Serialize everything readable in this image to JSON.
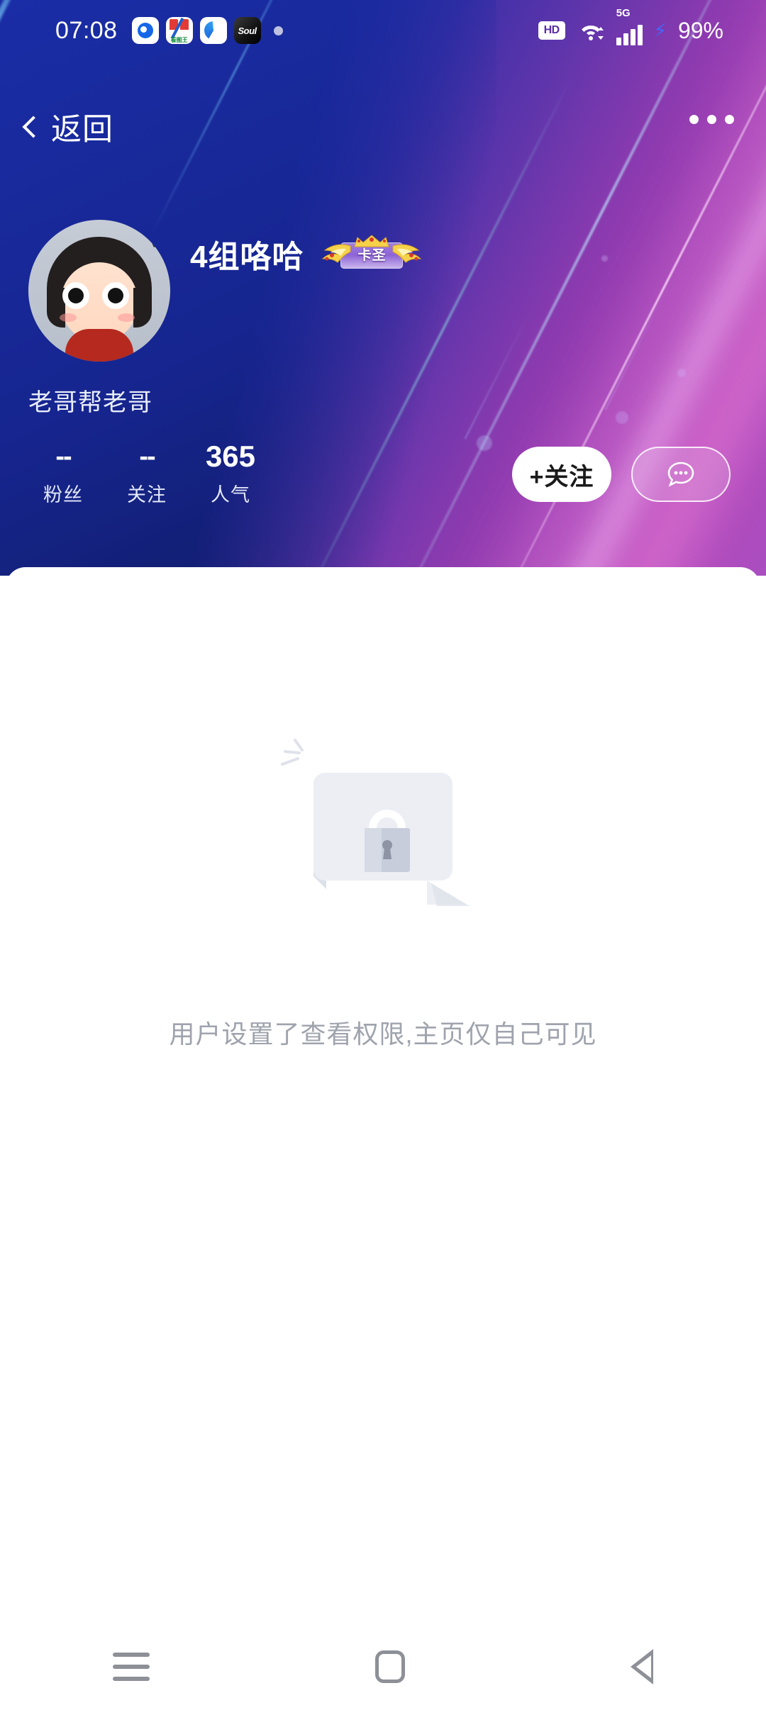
{
  "statusbar": {
    "clock": "07:08",
    "app_icons": [
      {
        "name": "app-notification-icon-1",
        "label": ""
      },
      {
        "name": "app-notification-icon-2",
        "label": "看图王"
      },
      {
        "name": "app-notification-icon-3",
        "label": ""
      },
      {
        "name": "app-notification-icon-soul",
        "label": "Soul"
      }
    ],
    "hd_label": "HD",
    "network_label": "5G",
    "battery_label": "99%"
  },
  "topbar": {
    "back_label": "返回",
    "more_label": "..."
  },
  "profile": {
    "username": "4组咯哈",
    "badge_label": "卡圣",
    "bio": "老哥帮老哥",
    "stats": [
      {
        "value": "--",
        "label": "粉丝"
      },
      {
        "value": "--",
        "label": "关注"
      },
      {
        "value": "365",
        "label": "人气"
      }
    ],
    "follow_button": "+关注",
    "message_button": ""
  },
  "content": {
    "empty_message": "用户设置了查看权限,主页仅自己可见"
  },
  "androidnav": {
    "recents_label": "",
    "home_label": "",
    "back_label": ""
  },
  "colors": {
    "hero_start": "#1b2ea8",
    "hero_end": "#b646b8",
    "panel_bg": "#ffffff",
    "empty_text": "#9fa3ad",
    "follow_bg": "#ffffff",
    "nav_icon": "#8d9096",
    "charging_bolt": "#3e6bff"
  }
}
